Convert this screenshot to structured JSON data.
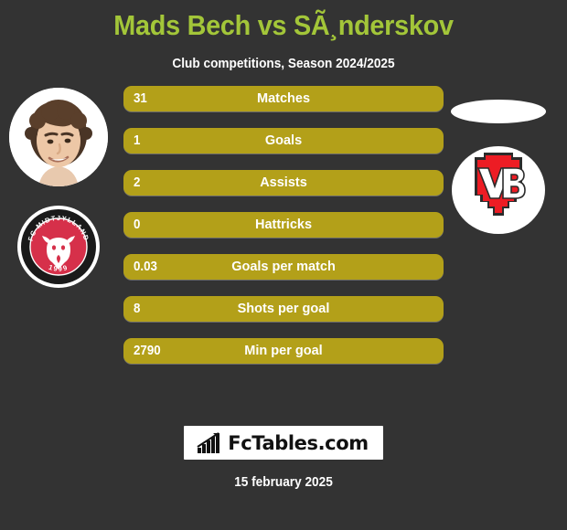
{
  "header": {
    "title": "Mads Bech vs SÃ¸nderskov",
    "subtitle": "Club competitions, Season 2024/2025"
  },
  "home": {
    "player_photo_alt": "Mads Bech",
    "club_badge_name": "FC Midtjylland",
    "club_badge_text_top": "FC MIDTJYLLAND",
    "club_badge_year": "1999"
  },
  "away": {
    "player_photo_alt": "",
    "club_badge_name": "VB",
    "club_badge_text": "VB"
  },
  "stats": [
    {
      "label": "Matches",
      "value": "31"
    },
    {
      "label": "Goals",
      "value": "1"
    },
    {
      "label": "Assists",
      "value": "2"
    },
    {
      "label": "Hattricks",
      "value": "0"
    },
    {
      "label": "Goals per match",
      "value": "0.03"
    },
    {
      "label": "Shots per goal",
      "value": "8"
    },
    {
      "label": "Min per goal",
      "value": "2790"
    }
  ],
  "footer": {
    "brand": "FcTables.com",
    "brand_icon": "bar-chart-icon",
    "date": "15 february 2025"
  },
  "colors": {
    "background": "#333333",
    "title": "#a3c639",
    "bar": "#b3a019",
    "text": "#ffffff",
    "badge_red": "#e8252a",
    "badge_crimson": "#d6304a"
  }
}
